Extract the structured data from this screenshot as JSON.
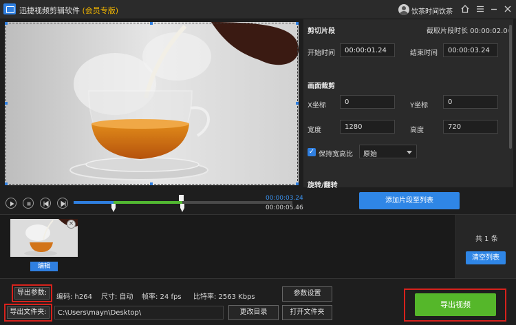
{
  "window": {
    "title": "迅捷视频剪辑软件",
    "edition": "(会员专版)",
    "user_name": "饮茶时间饮茶",
    "icons": [
      "home-icon",
      "menu-icon",
      "minimize-icon",
      "close-icon"
    ]
  },
  "player": {
    "current_time": "00:00:03.24",
    "total_time": "00:00:05.46",
    "progress": 0.18,
    "selection_start": 0.18,
    "selection_end": 0.49
  },
  "clip_panel": {
    "section_cut": "剪切片段",
    "clip_duration": "截取片段时长 00:00:02.00",
    "start_label": "开始时间",
    "start_value": "00:00:01.24",
    "end_label": "结束时间",
    "end_value": "00:00:03.24",
    "section_crop": "画面裁剪",
    "x_label": "X坐标",
    "x_value": "0",
    "y_label": "Y坐标",
    "y_value": "0",
    "width_label": "宽度",
    "width_value": "1280",
    "height_label": "高度",
    "height_value": "720",
    "keep_ratio_label": "保持宽高比",
    "keep_ratio_checked": true,
    "ratio_value": "原始",
    "section_rotate": "旋转/翻转",
    "add_clip_button": "添加片段至列表"
  },
  "clip_list": {
    "edit_button": "编辑",
    "count_label": "共 1 条",
    "clear_button": "清空列表"
  },
  "export": {
    "params_label": "导出参数:",
    "codec": "编码:  h264",
    "size": "尺寸:  自动",
    "fps": "帧率:  24 fps",
    "bitrate": "比特率:  2563 Kbps",
    "params_button": "参数设置",
    "folder_label": "导出文件夹:",
    "folder_path": "C:\\Users\\mayn\\Desktop\\",
    "change_dir_button": "更改目录",
    "open_folder_button": "打开文件夹",
    "export_button": "导出视频"
  },
  "colors": {
    "accent_blue": "#2f86e6",
    "green": "#55b72a",
    "highlight_red": "#d8221c",
    "vip_gold": "#f0b400"
  }
}
